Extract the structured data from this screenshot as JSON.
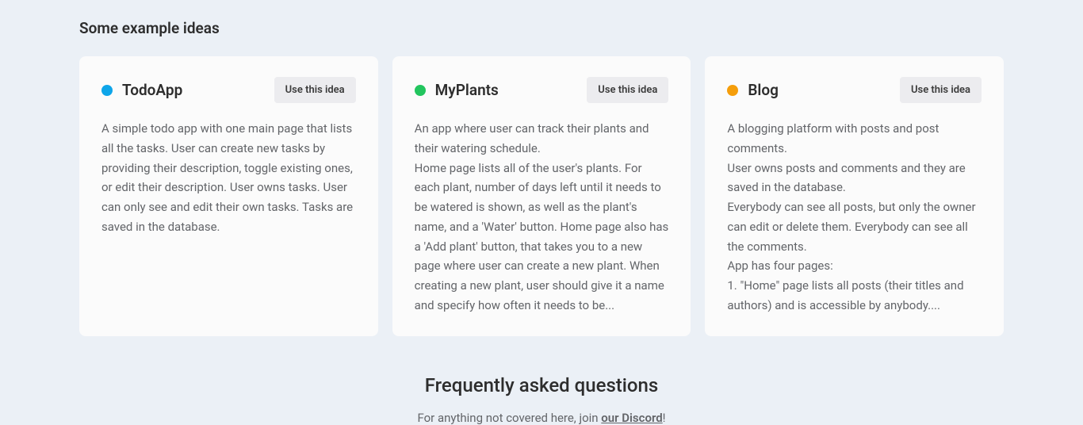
{
  "section_title": "Some example ideas",
  "use_button_label": "Use this idea",
  "ideas": [
    {
      "dot_color": "blue",
      "title": "TodoApp",
      "description": "A simple todo app with one main page that lists all the tasks. User can create new tasks by providing their description, toggle existing ones, or edit their description. User owns tasks. User can only see and edit their own tasks. Tasks are saved in the database."
    },
    {
      "dot_color": "green",
      "title": "MyPlants",
      "description": "An app where user can track their plants and their watering schedule.\nHome page lists all of the user's plants. For each plant, number of days left until it needs to be watered is shown, as well as the plant's name, and a 'Water' button. Home page also has a 'Add plant' button, that takes you to a new page where user can create a new plant. When creating a new plant, user should give it a name and specify how often it needs to be..."
    },
    {
      "dot_color": "orange",
      "title": "Blog",
      "description": "A blogging platform with posts and post comments.\nUser owns posts and comments and they are saved in the database.\nEverybody can see all posts, but only the owner can edit or delete them. Everybody can see all the comments.\nApp has four pages:\n1. \"Home\" page lists all posts (their titles and authors) and is accessible by anybody...."
    }
  ],
  "faq": {
    "title": "Frequently asked questions",
    "subtitle_prefix": "For anything not covered here, join ",
    "link_text": "our Discord",
    "subtitle_suffix": "!"
  }
}
